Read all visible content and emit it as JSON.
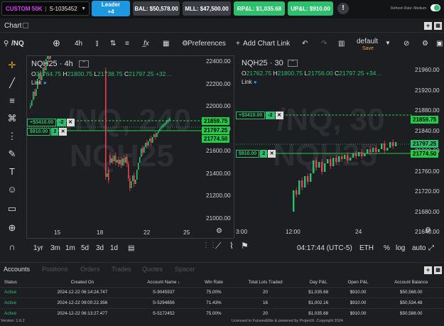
{
  "header": {
    "account_name": "CUSTOM 50K",
    "account_id": "S-1035452",
    "leader_label": "Leader",
    "leader_count": "+4",
    "balance": "BAL: $50,578.00",
    "mll": "MLL: $47,500.00",
    "rpl": "RP&L: $1,035.68",
    "upl": "UP&L: $910.00",
    "refresh": "Refresh Rate: Medium"
  },
  "chart_tab": {
    "label": "Chart"
  },
  "toolbar": {
    "symbol": "/NQ",
    "interval": "4h",
    "preferences": "Preferences",
    "add_chart_link": "Add Chart Link",
    "layout_name": "default",
    "layout_save": "Save"
  },
  "left_chart": {
    "title": "NQH25 · 4h",
    "ohlc": {
      "o": "21764.75",
      "h": "21800.75",
      "l": "21738.75",
      "c": "21797.25",
      "chg": "+32…"
    },
    "link": "Link",
    "watermark1": "/NQ, 240",
    "watermark2": "NQH25",
    "y_ticks": [
      "22400.00",
      "22200.00",
      "22000.00",
      "21800.00",
      "21600.00",
      "21400.00",
      "21200.00",
      "21000.00"
    ],
    "x_ticks": [
      "15",
      "18",
      "22",
      "25"
    ],
    "price_labels": [
      {
        "text": "21859.75",
        "color": "#22cc44"
      },
      {
        "text": "21797.25",
        "color": "#22cc44"
      },
      {
        "text": "21774.50",
        "color": "#22cc44"
      }
    ],
    "orders": [
      {
        "value": "+$3410.00",
        "qty": "-2"
      },
      {
        "value": "$910.00",
        "qty": "2"
      }
    ]
  },
  "right_chart": {
    "title": "NQH25 · 30",
    "ohlc": {
      "o": "21762.75",
      "h": "21800.75",
      "l": "21756.00",
      "c": "21797.25",
      "chg": "+34…"
    },
    "link": "Link",
    "watermark1": "/NQ, 30",
    "watermark2": "NQH25",
    "y_ticks": [
      "21960.00",
      "21920.00",
      "21880.00",
      "21840.00",
      "21800.00",
      "21760.00",
      "21720.00",
      "21680.00",
      "21640.00"
    ],
    "x_ticks": [
      "3:00",
      "12:00",
      "24"
    ],
    "price_labels": [
      {
        "text": "21859.75",
        "color": "#22cc44"
      },
      {
        "text": "21797.25",
        "color": "#2ebf6e"
      },
      {
        "text": "21774.50",
        "color": "#22cc44"
      }
    ],
    "orders": [
      {
        "value": "+$3410.00",
        "qty": "-2"
      },
      {
        "value": "$910.00",
        "qty": "2"
      }
    ]
  },
  "bottom_bar": {
    "ranges": [
      "1yr",
      "3m",
      "1m",
      "5d",
      "3d",
      "1d"
    ],
    "time": "04:17:44 (UTC-5)",
    "instrument": "ETH",
    "percent": "%",
    "log": "log",
    "auto": "auto"
  },
  "panel": {
    "tabs": [
      "Accounts",
      "Positions",
      "Orders",
      "Trades",
      "Quotes",
      "Spacer"
    ],
    "columns": [
      "Status",
      "Created On",
      "Account Name",
      "Win Rate",
      "Total Lots Traded",
      "Day P&L",
      "Open P&L",
      "Account Balance"
    ],
    "rows": [
      [
        "Active",
        "2024-12-22 06:14:24.747",
        "S-9045937",
        "75.00%",
        "20",
        "$1,035.68",
        "$910.00",
        "$50,568.00"
      ],
      [
        "Active",
        "2024-12-22 09:00:22.356",
        "S-5294856",
        "71.43%",
        "16",
        "$1,002.16",
        "$910.00",
        "$50,534.48"
      ],
      [
        "Active",
        "2024-12-22 06:13:27.477",
        "S-5172452",
        "75.00%",
        "20",
        "$1,035.68",
        "$910.00",
        "$50,588.00"
      ]
    ],
    "sort_arrow": "↓"
  },
  "footer": {
    "version": "Version: 1.6.2",
    "license": "Licensed to FuturesElite & powered by ProjectX. Copyright 2024"
  },
  "colors": {
    "up": "#2ebf6e",
    "down": "#e8414f",
    "accent": "#1b98e0",
    "magenta": "#e23bff"
  }
}
